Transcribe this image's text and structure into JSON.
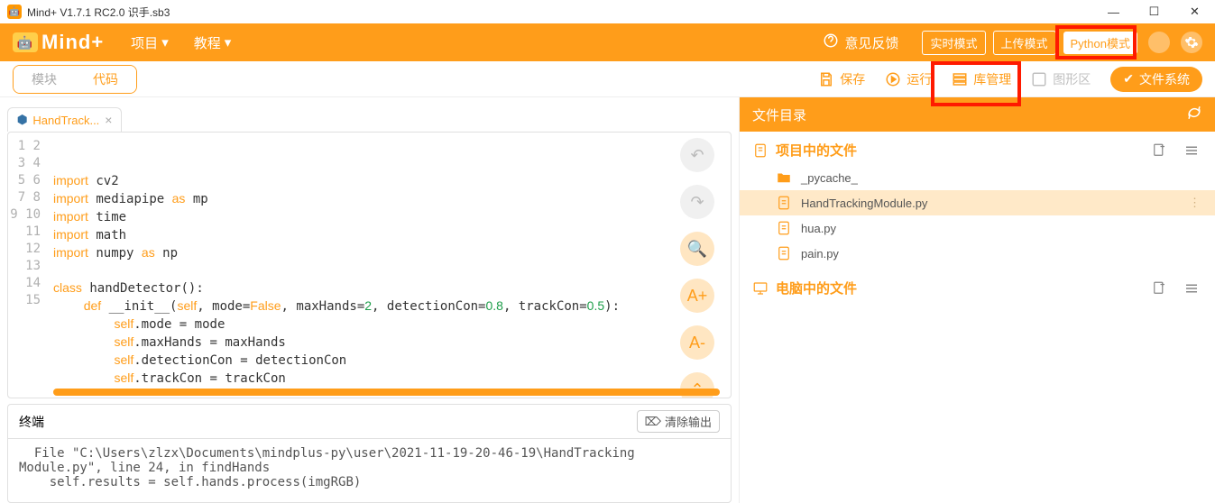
{
  "window": {
    "title": "Mind+ V1.7.1 RC2.0   识手.sb3"
  },
  "header": {
    "logo": "Mind+",
    "menu": {
      "project": "项目",
      "tutorial": "教程"
    },
    "feedback": "意见反馈",
    "modes": {
      "realtime": "实时模式",
      "upload": "上传模式",
      "python": "Python模式"
    }
  },
  "subbar": {
    "tabs": {
      "blocks": "模块",
      "code": "代码"
    },
    "buttons": {
      "save": "保存",
      "run": "运行",
      "libs": "库管理",
      "graph": "图形区",
      "fs": "文件系统"
    }
  },
  "editor": {
    "tab": "HandTrack...",
    "lines": [
      "",
      "",
      "import cv2",
      "import mediapipe as mp",
      "import time",
      "import math",
      "import numpy as np",
      "",
      "class handDetector():",
      "    def __init__(self, mode=False, maxHands=2, detectionCon=0.8, trackCon=0.5):",
      "        self.mode = mode",
      "        self.maxHands = maxHands",
      "        self.detectionCon = detectionCon",
      "        self.trackCon = trackCon",
      ""
    ],
    "side_btns": {
      "font_inc": "A+",
      "font_dec": "A-"
    }
  },
  "terminal": {
    "title": "终端",
    "clear": "清除输出",
    "body": "  File \"C:\\Users\\zlzx\\Documents\\mindplus-py\\user\\2021-11-19-20-46-19\\HandTracking\nModule.py\", line 24, in findHands\n    self.results = self.hands.process(imgRGB)"
  },
  "sidebar": {
    "head": "文件目录",
    "sec_project": "项目中的文件",
    "sec_computer": "电脑中的文件",
    "files": {
      "folder": "_pycache_",
      "f1": "HandTrackingModule.py",
      "f2": "hua.py",
      "f3": "pain.py"
    }
  }
}
